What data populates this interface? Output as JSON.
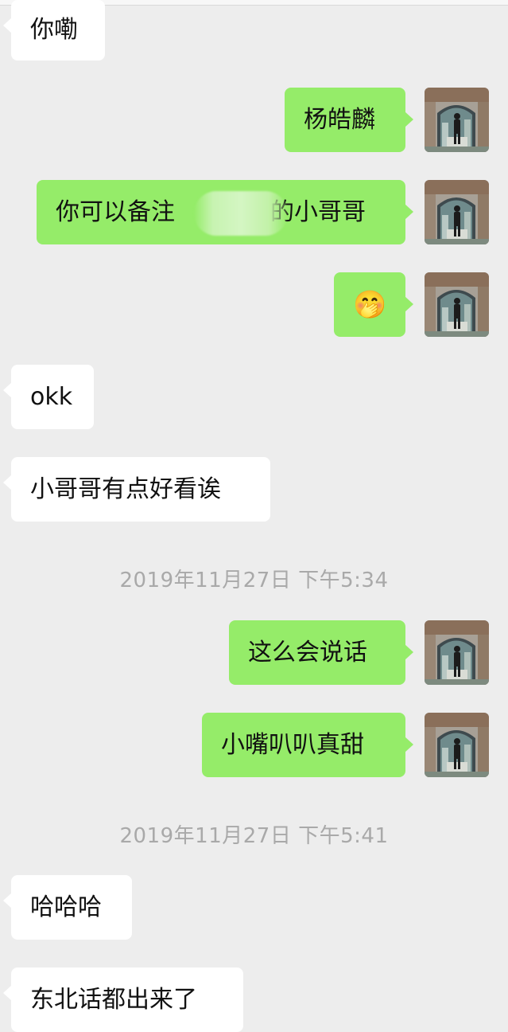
{
  "theme": {
    "background": "#ededed",
    "incoming_bubble": "#ffffff",
    "outgoing_bubble": "#95ec69",
    "timestamp_color": "#a9a9a9"
  },
  "messages": [
    {
      "side": "in",
      "text": "你嘞"
    },
    {
      "side": "out",
      "text": "杨皓麟"
    },
    {
      "side": "out",
      "text_before": "你可以备注",
      "text_after": "的小哥哥",
      "redacted": true
    },
    {
      "side": "out",
      "text": "🤭",
      "icon": "hand-over-mouth-emoji"
    },
    {
      "side": "in",
      "text": "okk"
    },
    {
      "side": "in",
      "text": "小哥哥有点好看诶"
    },
    {
      "side": "out",
      "text": "这么会说话"
    },
    {
      "side": "out",
      "text": "小嘴叭叭真甜"
    },
    {
      "side": "in",
      "text": "哈哈哈"
    },
    {
      "side": "in",
      "text": "东北话都出来了"
    }
  ],
  "timestamps": [
    "2019年11月27日 下午5:34",
    "2019年11月27日 下午5:41"
  ],
  "avatar_icon": "user-avatar-photo"
}
